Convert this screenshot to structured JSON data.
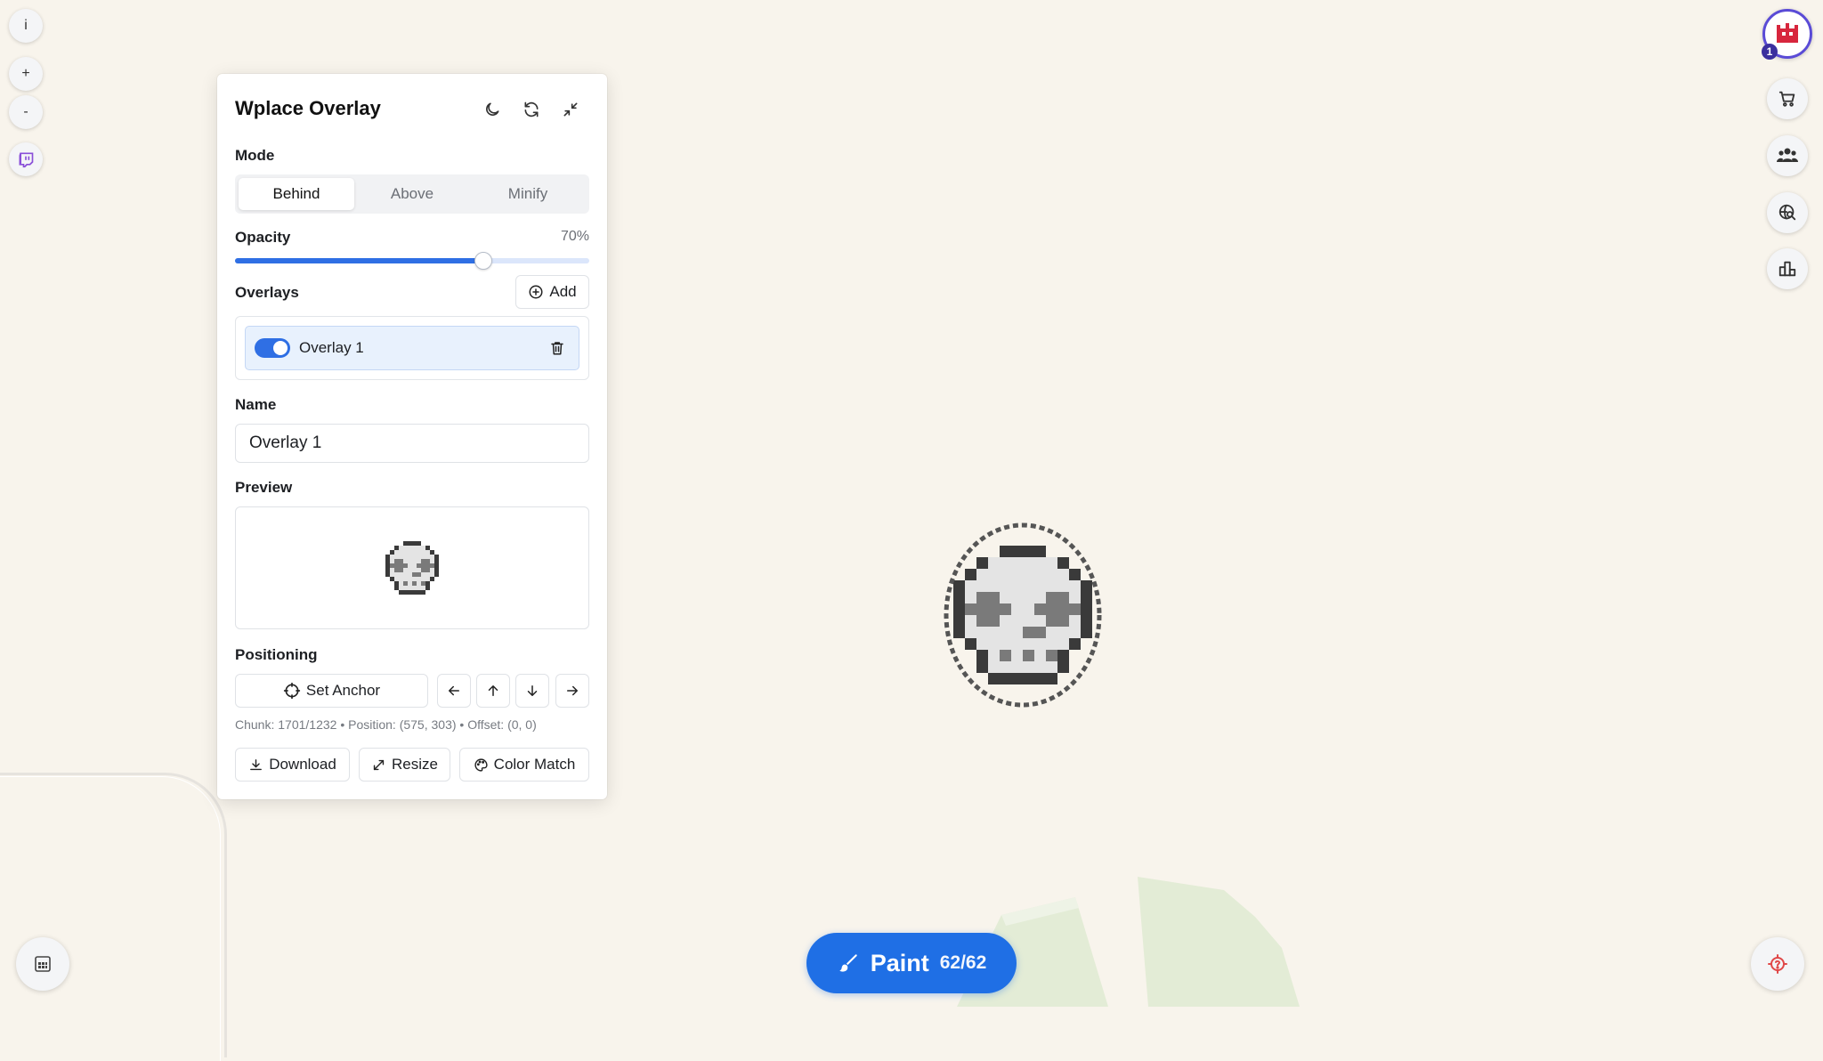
{
  "panel": {
    "title": "Wplace Overlay",
    "header_icons": [
      "moon-icon",
      "refresh-icon",
      "minimize-icon"
    ],
    "mode": {
      "label": "Mode",
      "options": [
        "Behind",
        "Above",
        "Minify"
      ],
      "selected": "Behind"
    },
    "opacity": {
      "label": "Opacity",
      "value_text": "70%",
      "value": 70
    },
    "overlays": {
      "label": "Overlays",
      "add_label": "Add",
      "items": [
        {
          "name": "Overlay 1",
          "enabled": true
        }
      ]
    },
    "name": {
      "label": "Name",
      "value": "Overlay 1"
    },
    "preview": {
      "label": "Preview"
    },
    "positioning": {
      "label": "Positioning",
      "set_anchor_label": "Set Anchor",
      "arrows": [
        "arrow-left-icon",
        "arrow-up-icon",
        "arrow-down-icon",
        "arrow-right-icon"
      ],
      "coords_text": "Chunk: 1701/1232 • Position: (575, 303) • Offset: (0, 0)"
    },
    "actions": {
      "download_label": "Download",
      "resize_label": "Resize",
      "color_match_label": "Color Match"
    }
  },
  "left_toolbar": {
    "info_label": "i",
    "zoom_in_label": "+",
    "zoom_out_label": "-",
    "icons": [
      "info-icon",
      "zoom-in-icon",
      "zoom-out-icon",
      "twitch-icon",
      "palette-grid-icon"
    ]
  },
  "right_toolbar": {
    "level": "1",
    "icons": [
      "avatar",
      "cart-icon",
      "users-icon",
      "globe-search-icon",
      "leaderboard-icon",
      "location-target-icon"
    ]
  },
  "paint": {
    "label": "Paint",
    "count": "62/62"
  },
  "colors": {
    "accent": "#2f6fe4",
    "paint_button": "#1f6fe5",
    "map_background": "#f8f4ec",
    "map_green": "#e3ecd6"
  }
}
